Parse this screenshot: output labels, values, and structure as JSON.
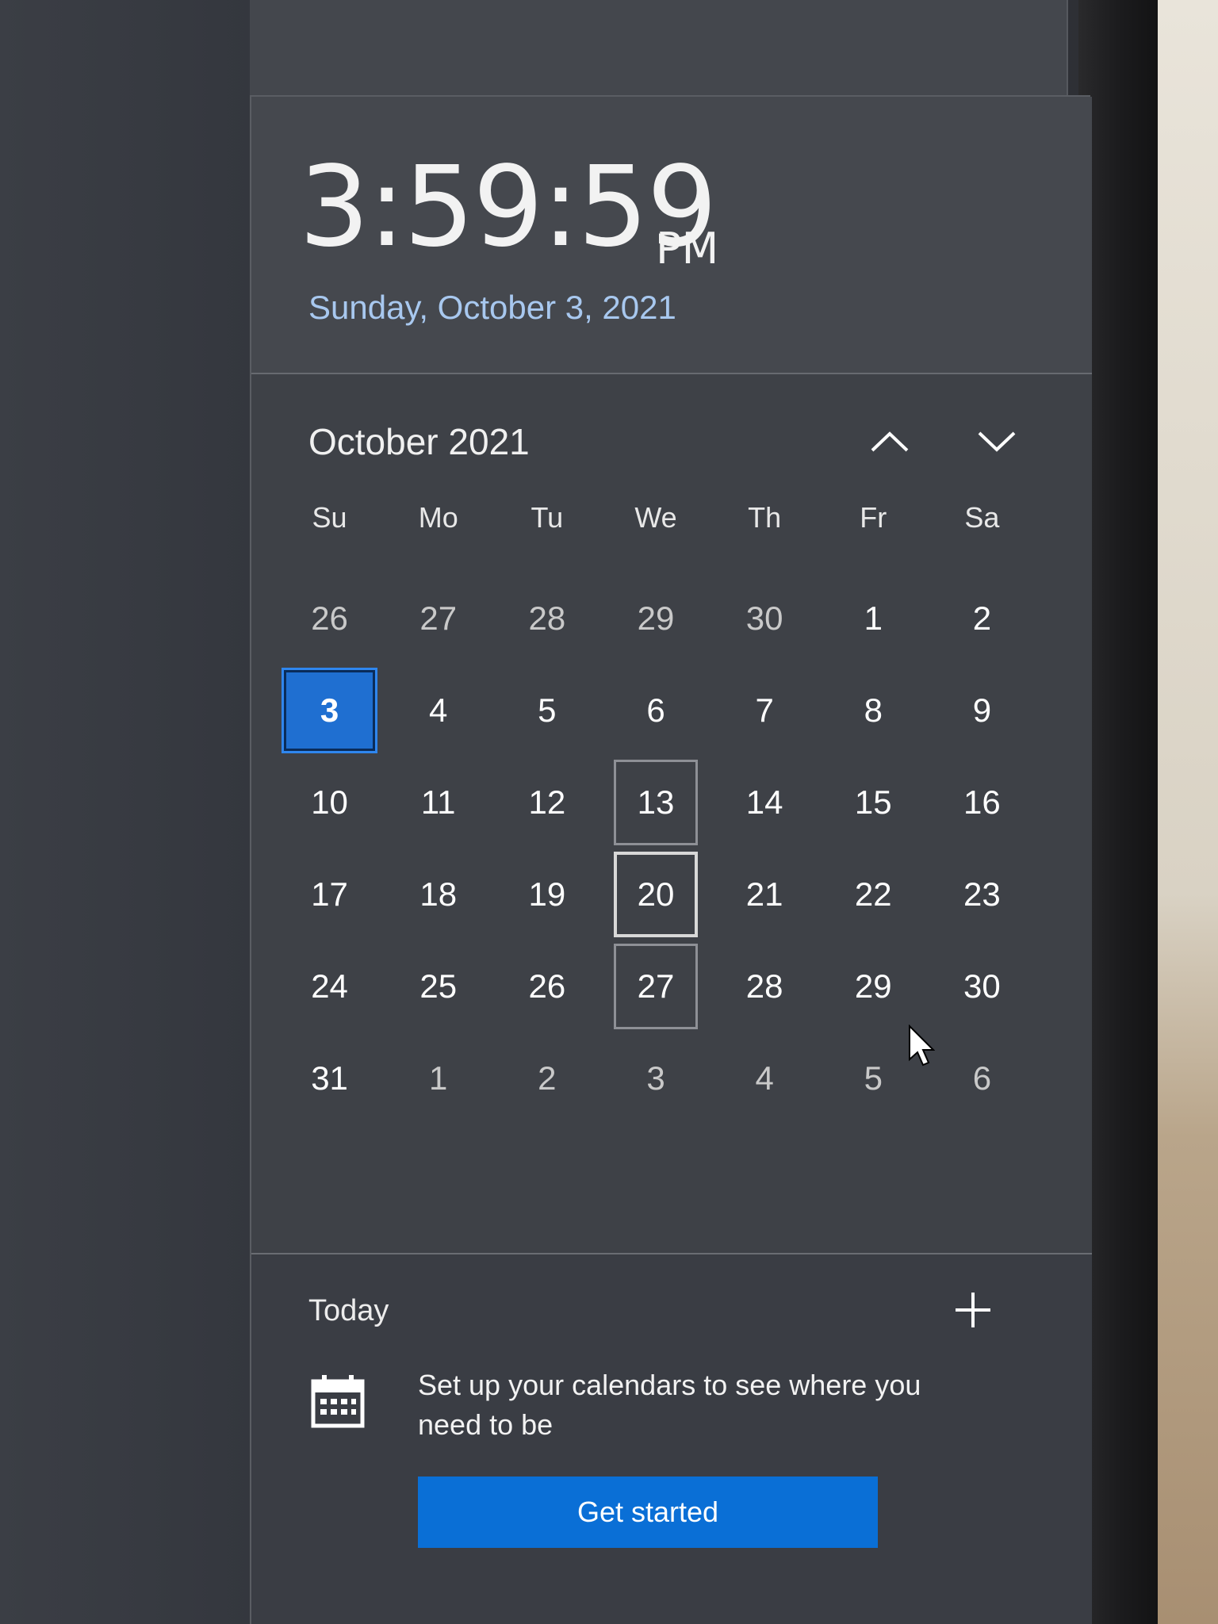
{
  "clock": {
    "time": "3:59:59",
    "ampm": "PM",
    "date": "Sunday, October 3, 2021"
  },
  "calendar": {
    "month_label": "October 2021",
    "weekdays": [
      "Su",
      "Mo",
      "Tu",
      "We",
      "Th",
      "Fr",
      "Sa"
    ],
    "days": [
      {
        "label": "26",
        "other": true
      },
      {
        "label": "27",
        "other": true
      },
      {
        "label": "28",
        "other": true
      },
      {
        "label": "29",
        "other": true
      },
      {
        "label": "30",
        "other": true
      },
      {
        "label": "1"
      },
      {
        "label": "2"
      },
      {
        "label": "3",
        "today": true
      },
      {
        "label": "4"
      },
      {
        "label": "5"
      },
      {
        "label": "6"
      },
      {
        "label": "7"
      },
      {
        "label": "8"
      },
      {
        "label": "9"
      },
      {
        "label": "10"
      },
      {
        "label": "11"
      },
      {
        "label": "12"
      },
      {
        "label": "13",
        "reveal": true
      },
      {
        "label": "14"
      },
      {
        "label": "15"
      },
      {
        "label": "16"
      },
      {
        "label": "17"
      },
      {
        "label": "18"
      },
      {
        "label": "19"
      },
      {
        "label": "20",
        "hover": true
      },
      {
        "label": "21"
      },
      {
        "label": "22"
      },
      {
        "label": "23"
      },
      {
        "label": "24"
      },
      {
        "label": "25"
      },
      {
        "label": "26"
      },
      {
        "label": "27",
        "reveal": true
      },
      {
        "label": "28"
      },
      {
        "label": "29"
      },
      {
        "label": "30"
      },
      {
        "label": "31"
      },
      {
        "label": "1",
        "other": true
      },
      {
        "label": "2",
        "other": true
      },
      {
        "label": "3",
        "other": true
      },
      {
        "label": "4",
        "other": true
      },
      {
        "label": "5",
        "other": true
      },
      {
        "label": "6",
        "other": true
      }
    ],
    "nav_icons": [
      "chevron-up-icon",
      "chevron-down-icon"
    ]
  },
  "agenda": {
    "today_label": "Today",
    "add_icon": "plus-icon",
    "calendar_icon": "calendar-icon",
    "setup_text": "Set up your calendars to see where you need to be",
    "button_label": "Get started"
  },
  "colors": {
    "accent": "#0a6fd6",
    "today_highlight": "#1f6fd1",
    "date_link": "#a8c8ef"
  }
}
